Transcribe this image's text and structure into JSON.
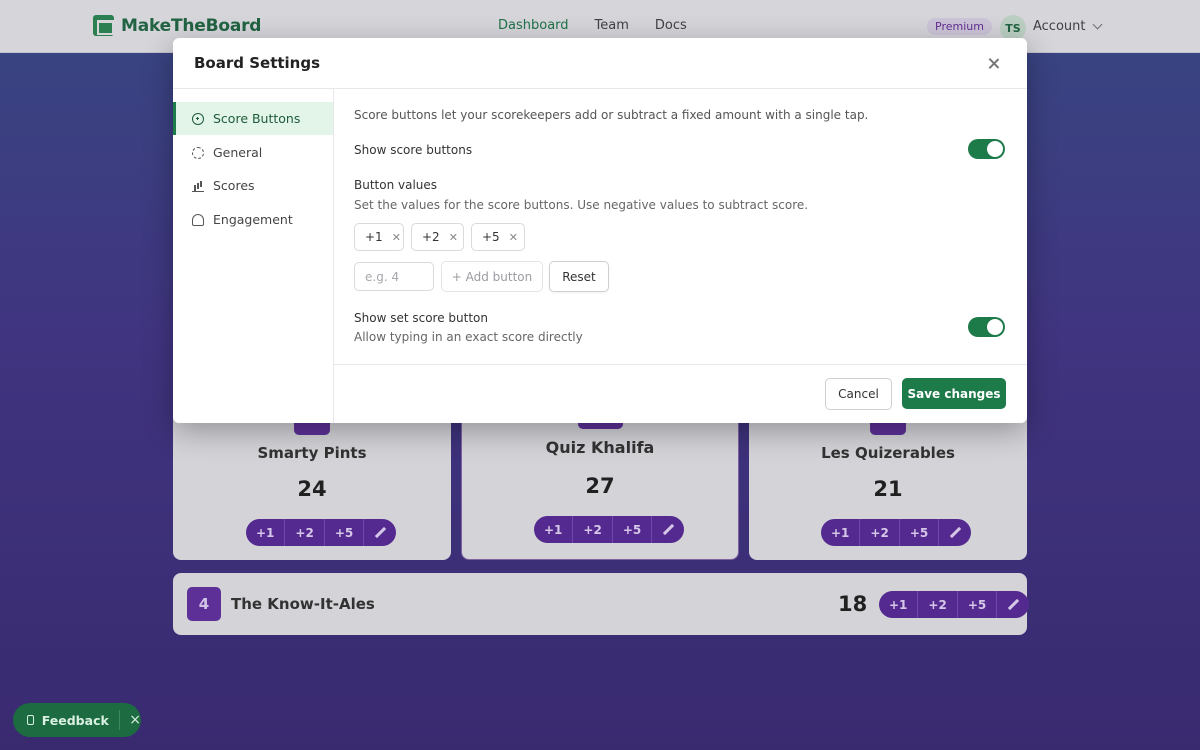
{
  "app": {
    "brand": "MakeTheBoard",
    "nav": [
      "Dashboard",
      "Team",
      "Docs"
    ],
    "premium_badge": "Premium",
    "avatar_initials": "TS",
    "account_label": "Account"
  },
  "board": {
    "teams": [
      {
        "name": "Smarty Pints",
        "score": "24"
      },
      {
        "name": "Quiz Khalifa",
        "score": "27"
      },
      {
        "name": "Les Quizerables",
        "score": "21"
      }
    ],
    "row_team": {
      "rank": "4",
      "name": "The Know-It-Ales",
      "score": "18"
    },
    "score_buttons": [
      "+1",
      "+2",
      "+5"
    ]
  },
  "feedback": {
    "label": "Feedback",
    "close": "×"
  },
  "modal": {
    "title": "Board Settings",
    "sidebar": [
      {
        "label": "Score Buttons",
        "icon": "plus-circle-icon"
      },
      {
        "label": "General",
        "icon": "gear-icon"
      },
      {
        "label": "Scores",
        "icon": "bar-chart-icon"
      },
      {
        "label": "Engagement",
        "icon": "people-icon"
      }
    ],
    "description": "Score buttons let your scorekeepers add or subtract a fixed amount with a single tap.",
    "show_score_buttons": {
      "label": "Show score buttons",
      "enabled": true
    },
    "button_values": {
      "label": "Button values",
      "help": "Set the values for the score buttons. Use negative values to subtract score.",
      "chips": [
        "+1",
        "+2",
        "+5"
      ],
      "input_placeholder": "e.g. 4",
      "add_label": "+ Add button",
      "reset_label": "Reset"
    },
    "show_set_score": {
      "label": "Show set score button",
      "help": "Allow typing in an exact score directly",
      "enabled": true
    },
    "cancel_label": "Cancel",
    "save_label": "Save changes"
  },
  "colors": {
    "accent": "#1d7a49",
    "team_purple": "#5a2a9c"
  }
}
